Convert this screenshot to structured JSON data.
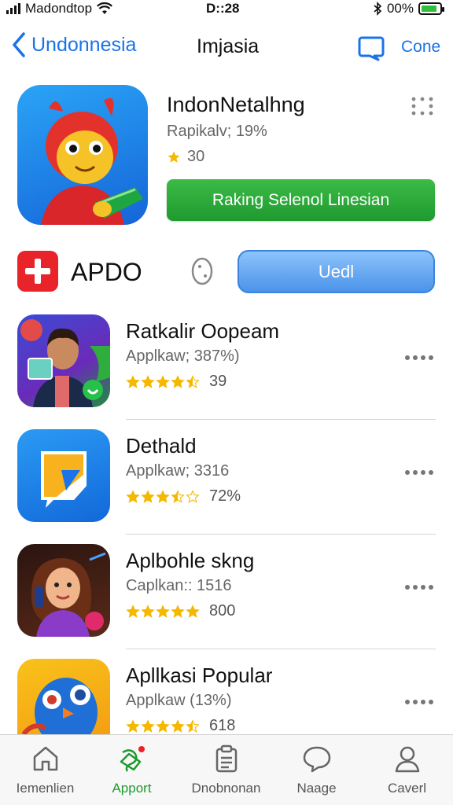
{
  "status_bar": {
    "carrier": "Madondtop",
    "time": "D::28",
    "battery": "00%",
    "battery_level": 0.85
  },
  "nav": {
    "back_label": "Undonnesia",
    "title": "Imjasia",
    "action_label": "Cone"
  },
  "featured": {
    "title": "IndonNetalhng",
    "subtitle": "Rapikalv; 19%",
    "rating": "30",
    "button_label": "Raking Selenol Linesian"
  },
  "section": {
    "title": "APDO",
    "button_label": "Uedl"
  },
  "apps": [
    {
      "name": "Ratkalir Oopeam",
      "subtitle": "Applkaw; 387%)",
      "rating_text": "39",
      "stars": 4.5
    },
    {
      "name": "Dethald",
      "subtitle": "Applkaw; 3316",
      "rating_text": "72%",
      "stars": 3.5
    },
    {
      "name": "Aplbohle skng",
      "subtitle": "Caplkan:: 1516",
      "rating_text": "800",
      "stars": 5
    },
    {
      "name": "Apllkasi Popular",
      "subtitle": "Applkaw (13%)",
      "rating_text": "618",
      "stars": 4.5
    }
  ],
  "tabs": [
    {
      "label": "Iemenlien",
      "icon": "home-icon"
    },
    {
      "label": "Apport",
      "icon": "apps-icon"
    },
    {
      "label": "Dnobnonan",
      "icon": "clipboard-icon"
    },
    {
      "label": "Naage",
      "icon": "chat-icon"
    },
    {
      "label": "Caverl",
      "icon": "person-icon"
    }
  ],
  "colors": {
    "accent_blue": "#1a73e8",
    "green_button": "#1f9a2f",
    "star": "#f5b800",
    "section_logo": "#e8232a"
  }
}
